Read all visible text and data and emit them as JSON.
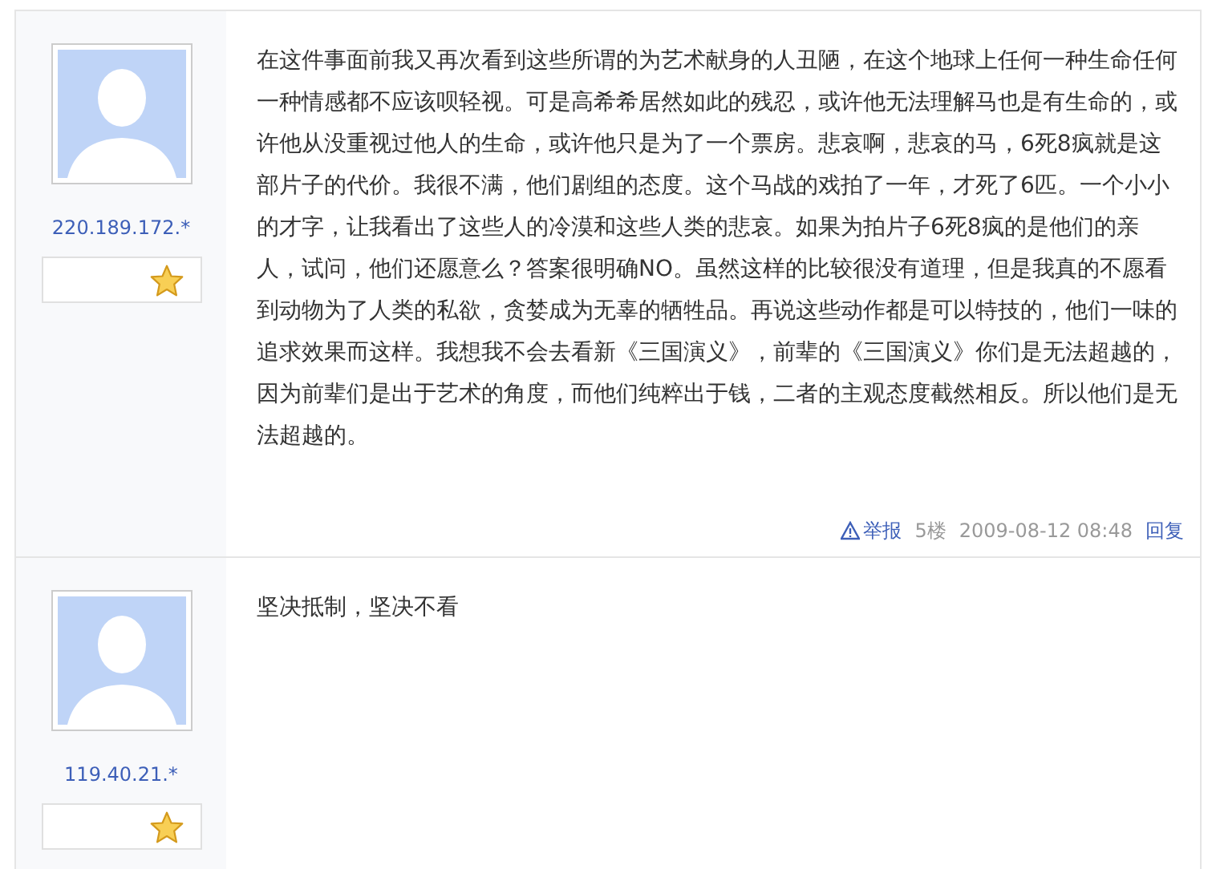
{
  "posts": [
    {
      "ip": "220.189.172.*",
      "content": "在这件事面前我又再次看到这些所谓的为艺术献身的人丑陋，在这个地球上任何一种生命任何一种情感都不应该呗轻视。可是高希希居然如此的残忍，或许他无法理解马也是有生命的，或许他从没重视过他人的生命，或许他只是为了一个票房。悲哀啊，悲哀的马，6死8疯就是这部片子的代价。我很不满，他们剧组的态度。这个马战的戏拍了一年，才死了6匹。一个小小的才字，让我看出了这些人的冷漠和这些人类的悲哀。如果为拍片子6死8疯的是他们的亲人，试问，他们还愿意么？答案很明确NO。虽然这样的比较很没有道理，但是我真的不愿看到动物为了人类的私欲，贪婪成为无辜的牺牲品。再说这些动作都是可以特技的，他们一味的追求效果而这样。我想我不会去看新《三国演义》，前辈的《三国演义》你们是无法超越的，因为前辈们是出于艺术的角度，而他们纯粹出于钱，二者的主观态度截然相反。所以他们是无法超越的。",
      "footer": {
        "report": "举报",
        "floor": "5楼",
        "time": "2009-08-12 08:48",
        "reply": "回复"
      }
    },
    {
      "ip": "119.40.21.*",
      "content": "坚决抵制，坚决不看"
    }
  ]
}
